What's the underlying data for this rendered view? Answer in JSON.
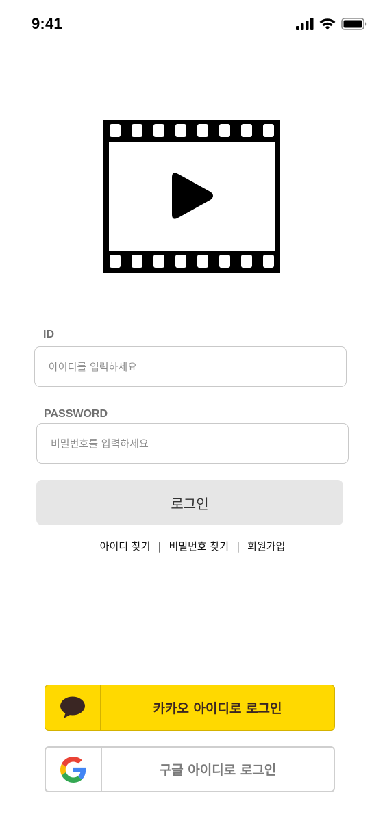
{
  "status_bar": {
    "time": "9:41",
    "icons": [
      "cellular-signal-icon",
      "wifi-icon",
      "battery-icon"
    ]
  },
  "logo": {
    "icon": "film-play-icon"
  },
  "form": {
    "id_label": "ID",
    "id_placeholder": "아이디를 입력하세요",
    "password_label": "PASSWORD",
    "password_placeholder": "비밀번호를 입력하세요",
    "login_label": "로그인"
  },
  "links": {
    "find_id": "아이디 찾기",
    "separator": "|",
    "find_password": "비밀번호 찾기",
    "signup": "회원가입"
  },
  "social": {
    "kakao_label": "카카오 아이디로 로그인",
    "kakao_icon": "speech-bubble-icon",
    "google_label": "구글 아이디로 로그인",
    "google_icon": "google-g-icon"
  },
  "colors": {
    "kakao_yellow": "#ffd900",
    "kakao_brown": "#3a2623",
    "login_button_bg": "#e6e6e6"
  }
}
